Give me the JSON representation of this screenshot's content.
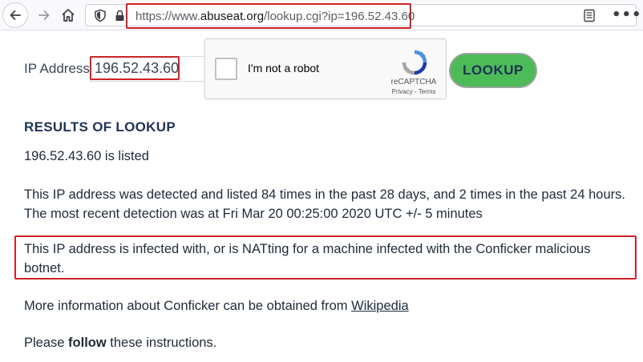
{
  "browser": {
    "url_prefix": "https://www.",
    "url_domain": "abuseat.org",
    "url_path": "/lookup.cgi?ip=196.52.43.60",
    "more_label": "•••"
  },
  "lookup_form": {
    "ip_label": "IP Address:",
    "ip_value": "196.52.43.60",
    "captcha_label": "I'm not a robot",
    "captcha_brand": "reCAPTCHA",
    "captcha_links": "Privacy - Terms",
    "lookup_button": "LOOKUP"
  },
  "results": {
    "title": "RESULTS OF LOOKUP",
    "listed": "196.52.43.60 is listed",
    "detected": "This IP address was detected and listed 84 times in the past 28 days, and 2 times in the past 24 hours. The most recent detection was at Fri Mar 20 00:25:00 2020 UTC +/- 5 minutes",
    "infected": "This IP address is infected with, or is NATting for a machine infected with the Conficker malicious botnet.",
    "more_info_prefix": "More information about Conficker can be obtained from ",
    "more_info_link": "Wikipedia",
    "follow_prefix": "Please ",
    "follow_bold": "follow",
    "follow_suffix": " these instructions."
  },
  "colors": {
    "highlight_border": "#cc2229",
    "lookup_button_bg": "#4dbb58",
    "heading": "#1d3354"
  }
}
